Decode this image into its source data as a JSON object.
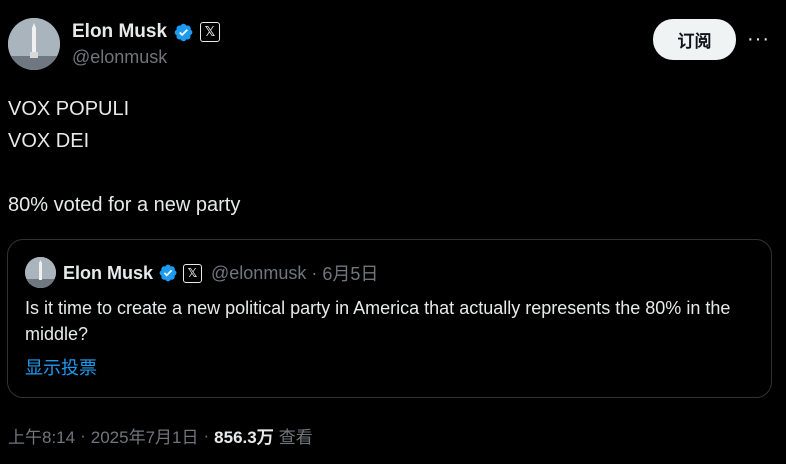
{
  "post": {
    "author_name": "Elon Musk",
    "author_handle": "@elonmusk",
    "subscribe_label": "订阅",
    "more_label": "···",
    "text_line1": "VOX POPULI",
    "text_line2": "VOX DEI",
    "text_line3": "80% voted for a new party"
  },
  "quote": {
    "author_name": "Elon Musk",
    "author_handle": "@elonmusk",
    "separator": "·",
    "date": "6月5日",
    "text": "Is it time to create a new political party in America that actually represents the 80% in the middle?",
    "show_poll_label": "显示投票"
  },
  "meta": {
    "time": "上午8:14",
    "separator": "·",
    "date": "2025年7月1日",
    "views_count": "856.3万",
    "views_label": "查看"
  },
  "colors": {
    "background": "#000000",
    "text": "#e7e9ea",
    "muted": "#71767b",
    "link": "#1d9bf0",
    "verified": "#1d9bf0",
    "border": "#2f3336"
  },
  "icons": {
    "verified": "verified-badge-icon",
    "x_logo": "x-logo-icon",
    "more": "more-options-icon"
  }
}
